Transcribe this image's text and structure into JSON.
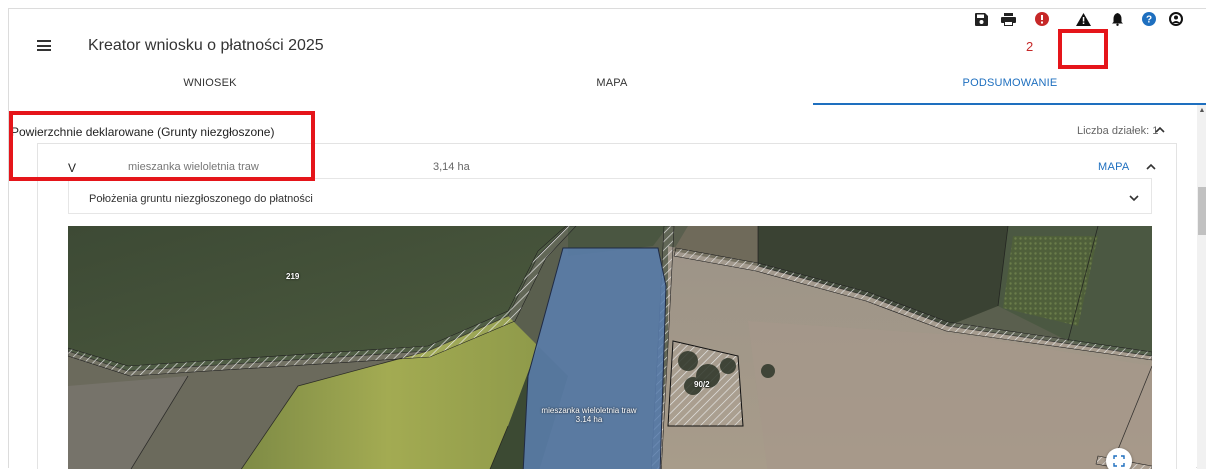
{
  "app": {
    "title": "Kreator wniosku o płatności 2025"
  },
  "toolbar": {
    "icons": [
      "save-icon",
      "print-icon",
      "error-icon",
      "warning-icon",
      "bell-icon",
      "help-icon",
      "account-icon"
    ],
    "error_count": "2",
    "colors": {
      "error": "#c62828",
      "help": "#1e6fbf",
      "highlight": "#e5151a"
    }
  },
  "tabs": [
    {
      "label": "WNIOSEK",
      "active": false
    },
    {
      "label": "MAPA",
      "active": false
    },
    {
      "label": "PODSUMOWANIE",
      "active": true
    }
  ],
  "section": {
    "title": "Powierzchnie deklarowane (Grunty niezgłoszone)",
    "count_label": "Liczba działek: 1"
  },
  "row": {
    "code": "V",
    "crop": "mieszanka wieloletnia traw",
    "area": "3,14 ha",
    "map_link": "MAPA"
  },
  "subpanel": {
    "title": "Położenia gruntu niezgłoszonego do płatności"
  },
  "map": {
    "labels": {
      "parcel_219": "219",
      "parcel_90_2": "90/2",
      "crop_line1": "mieszanka wieloletnia traw",
      "crop_line2": "3.14 ha"
    }
  }
}
